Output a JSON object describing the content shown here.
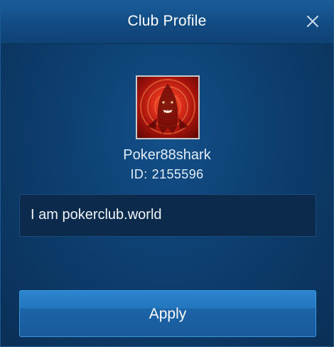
{
  "dialog": {
    "title": "Club Profile",
    "close_icon": "close-icon"
  },
  "profile": {
    "avatar_icon": "shark-avatar",
    "username": "Poker88shark",
    "id_label": "ID:",
    "id_value": "2155596",
    "bio": "I am pokerclub.world"
  },
  "actions": {
    "apply_label": "Apply"
  },
  "colors": {
    "background": "#0d3f70",
    "header": "#124b82",
    "bio_box": "#0b2a4c",
    "button": "#2375bd",
    "text": "#ffffff"
  }
}
